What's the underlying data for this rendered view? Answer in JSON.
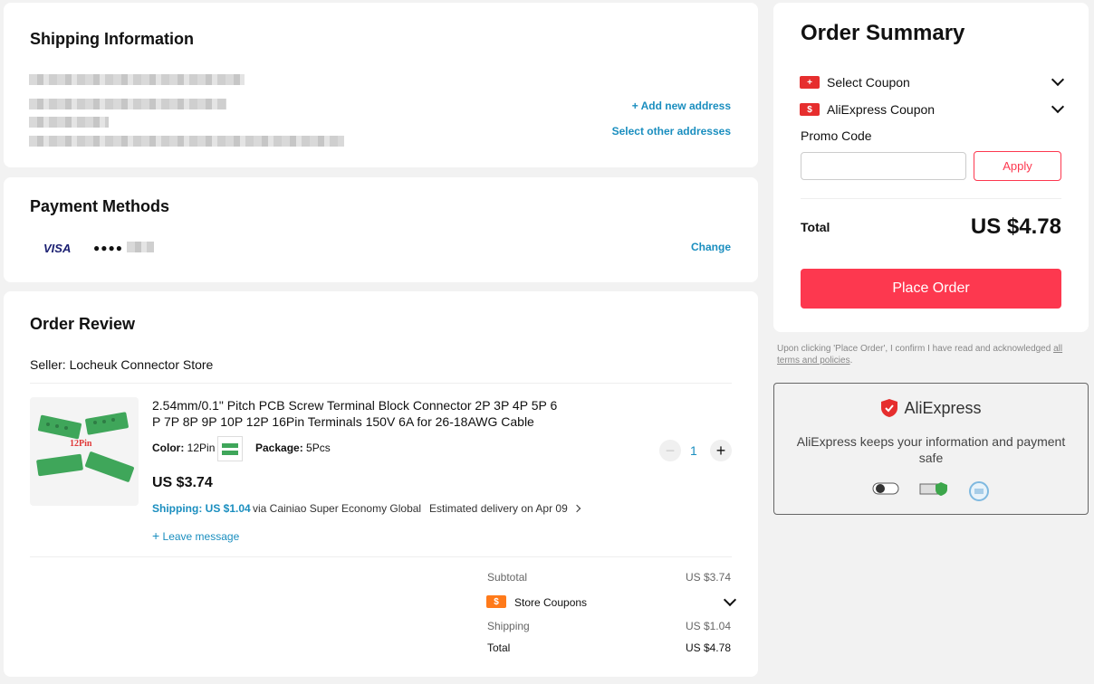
{
  "shipping": {
    "title": "Shipping Information",
    "add_address": "+ Add new address",
    "select_other": "Select other addresses"
  },
  "payment": {
    "title": "Payment Methods",
    "card_brand": "VISA",
    "card_dots": "●●●●",
    "change": "Change"
  },
  "review": {
    "title": "Order Review",
    "seller": "Seller: Locheuk Connector Store",
    "product": {
      "name_line1": "2.54mm/0.1\" Pitch PCB Screw Terminal Block Connector 2P 3P 4P 5P 6",
      "name_line2": "P 7P 8P 9P 10P 12P 16Pin Terminals 150V 6A for 26-18AWG Cable",
      "color_label": "Color:",
      "color_value": "12Pin",
      "package_label": "Package:",
      "package_value": "5Pcs",
      "image_label": "12Pin",
      "price": "US $3.74",
      "quantity": "1",
      "shipping_price": "Shipping: US $1.04",
      "shipping_method": "via Cainiao Super Economy Global",
      "delivery_label": "Estimated delivery on",
      "delivery_date": "Apr 09",
      "leave_message": "Leave message"
    },
    "summary": {
      "subtotal_label": "Subtotal",
      "subtotal_value": "US $3.74",
      "store_coupons": "Store Coupons",
      "shipping_label": "Shipping",
      "shipping_value": "US $1.04",
      "total_label": "Total",
      "total_value": "US $4.78"
    }
  },
  "order_summary": {
    "title": "Order Summary",
    "select_coupon": "Select Coupon",
    "aliexpress_coupon": "AliExpress Coupon",
    "promo_label": "Promo Code",
    "promo_value": "",
    "apply": "Apply",
    "total_label": "Total",
    "total_value": "US $4.78",
    "place_order": "Place Order"
  },
  "disclaimer": {
    "text": "Upon clicking 'Place Order', I confirm I have read and acknowledged ",
    "link": "all terms and policies",
    "end": "."
  },
  "trust": {
    "brand": "AliExpress",
    "message": "AliExpress keeps your information and payment safe"
  },
  "colors": {
    "accent_red": "#fd384f",
    "link_blue": "#1a8ebf"
  }
}
